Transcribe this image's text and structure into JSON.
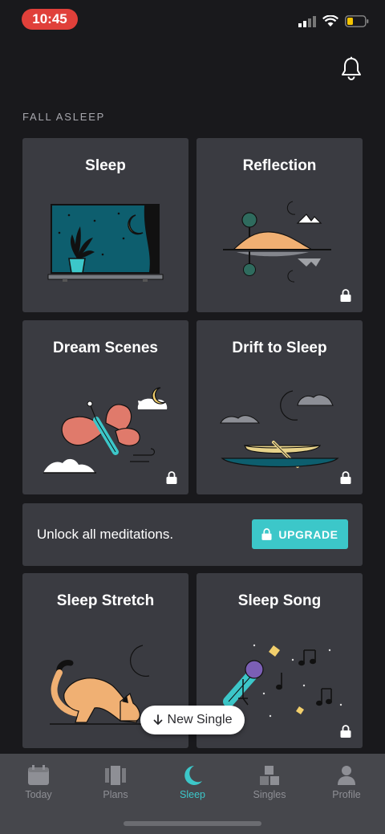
{
  "status_bar": {
    "time": "10:45",
    "time_pill_color": "#e0403a"
  },
  "section": {
    "title": "FALL ASLEEP"
  },
  "cards": [
    {
      "title": "Sleep",
      "locked": false
    },
    {
      "title": "Reflection",
      "locked": true
    },
    {
      "title": "Dream Scenes",
      "locked": true
    },
    {
      "title": "Drift to Sleep",
      "locked": true
    },
    {
      "title": "Sleep Stretch",
      "locked": true
    },
    {
      "title": "Sleep Song",
      "locked": true
    }
  ],
  "upgrade_banner": {
    "text": "Unlock all meditations.",
    "button_label": "UPGRADE",
    "accent": "#3cc7c9"
  },
  "toast": {
    "label": "New Single",
    "icon": "arrow-down-icon"
  },
  "tabbar": {
    "active": "Sleep",
    "items": [
      {
        "label": "Today",
        "icon": "calendar-icon"
      },
      {
        "label": "Plans",
        "icon": "plans-icon"
      },
      {
        "label": "Sleep",
        "icon": "moon-icon"
      },
      {
        "label": "Singles",
        "icon": "blocks-icon"
      },
      {
        "label": "Profile",
        "icon": "person-icon"
      }
    ]
  },
  "colors": {
    "background": "#19191c",
    "card": "#3a3b41",
    "tabbar": "#46474c",
    "accent": "#3cc7c9"
  }
}
